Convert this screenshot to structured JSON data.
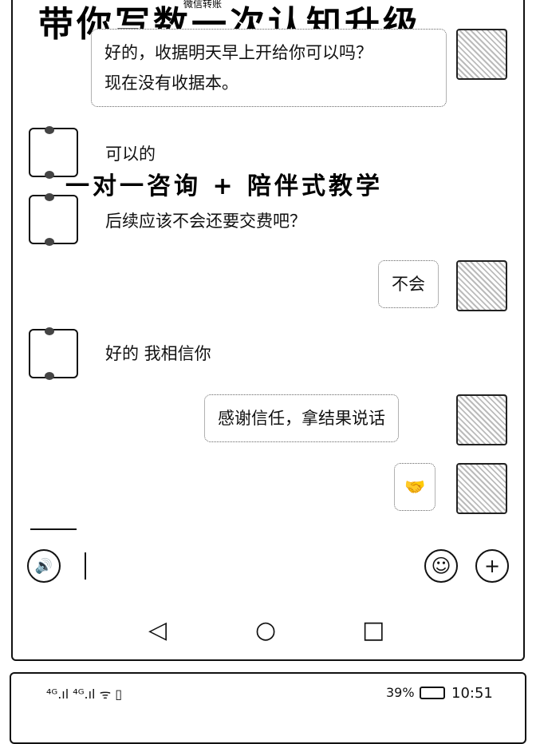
{
  "overlay": {
    "title": "带你写数一次认知升级",
    "subtitle": "微信转账",
    "banner": "一对一咨询 + 陪伴式教学"
  },
  "messages": [
    {
      "side": "right",
      "text1": "好的，收据明天早上开给你可以吗？",
      "text2": "现在没有收据本。"
    },
    {
      "side": "left",
      "text": "可以的"
    },
    {
      "side": "left",
      "text": "后续应该不会还要交费吧？"
    },
    {
      "side": "right",
      "text": "不会"
    },
    {
      "side": "left",
      "text": "好的 我相信你"
    },
    {
      "side": "right",
      "text": "感谢信任，拿结果说话"
    },
    {
      "side": "right",
      "emoji": "🤝"
    }
  ],
  "input": {
    "voice_icon": "voice-icon",
    "emoji_icon": "emoji-icon",
    "plus_icon": "plus-icon"
  },
  "nav": {
    "back": "◁",
    "home": "○",
    "recent": "□"
  },
  "status": {
    "left": "⁴ᴳ.ıl ⁴ᴳ.ıl ᯤ ▯",
    "battery": "39%",
    "time": "10:51"
  }
}
